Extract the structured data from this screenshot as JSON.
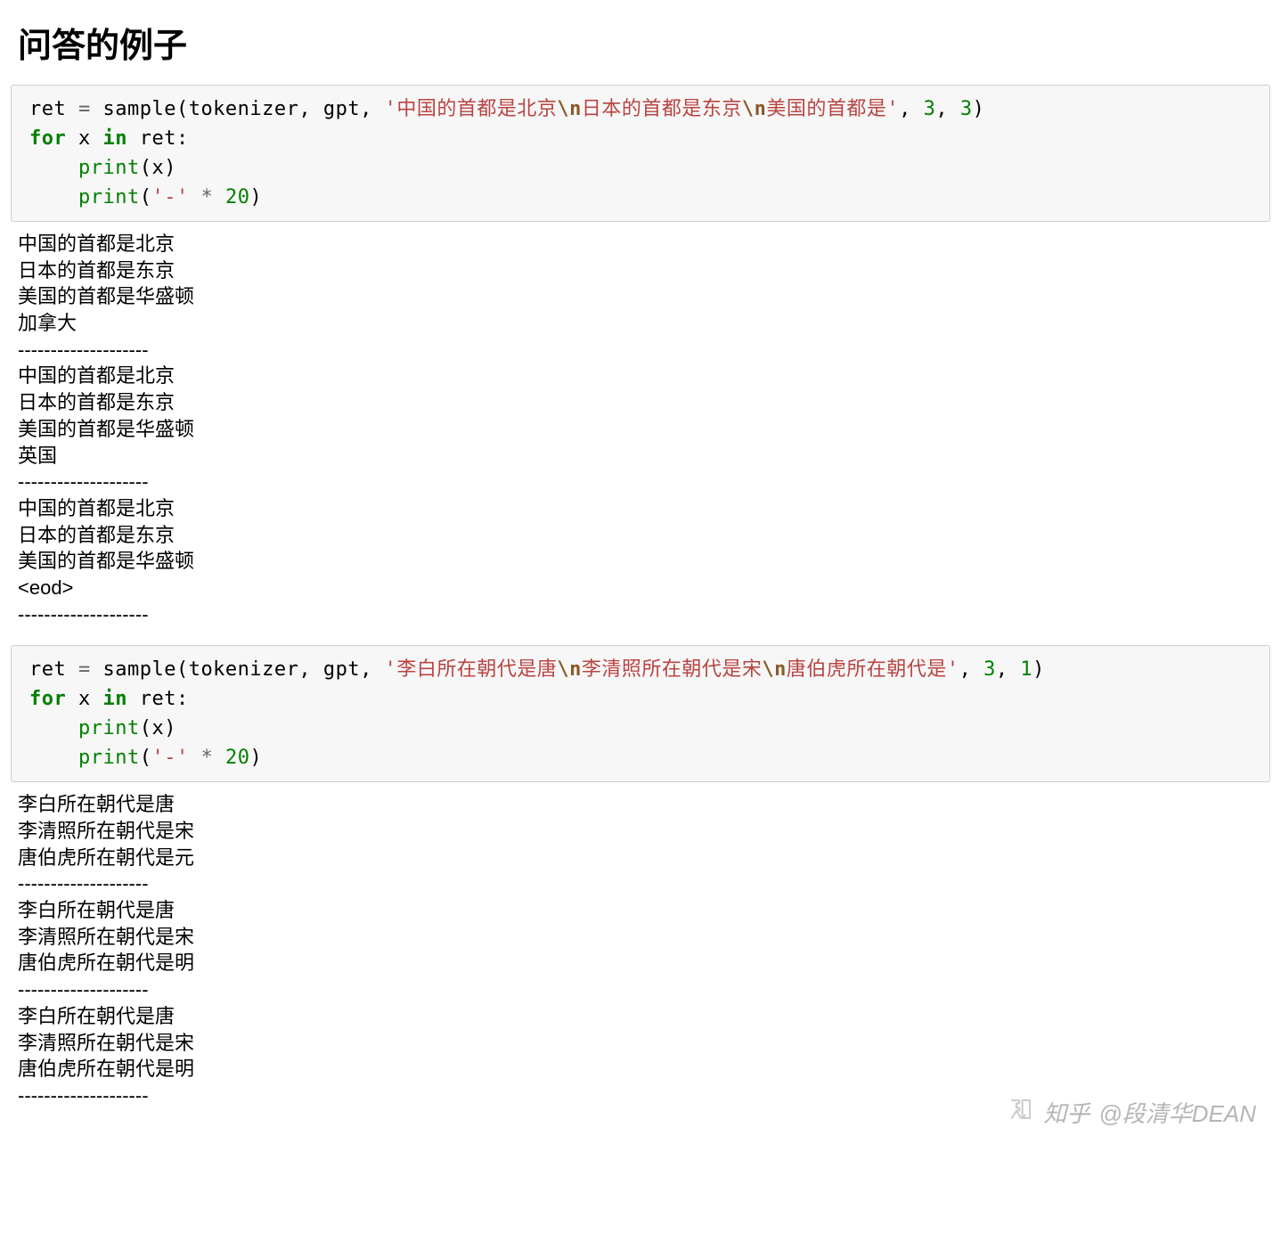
{
  "heading": "问答的例子",
  "cells": [
    {
      "code": {
        "line1_pre": "ret ",
        "line1_eq": "=",
        "line1_post": " sample(tokenizer, gpt, ",
        "str_open": "'",
        "str_p1": "中国的首都是北京",
        "str_e1": "\\n",
        "str_p2": "日本的首都是东京",
        "str_e2": "\\n",
        "str_p3": "美国的首都是",
        "str_close": "'",
        "line1_tail": ", ",
        "arg_a": "3",
        "comma": ", ",
        "arg_b": "3",
        "line1_end": ")",
        "line2_for": "for",
        "line2_mid": " x ",
        "line2_in": "in",
        "line2_rest": " ret:",
        "line3_indent": "    ",
        "line3_print": "print",
        "line3_rest": "(x)",
        "line4_indent": "    ",
        "line4_print": "print",
        "line4_open": "(",
        "line4_str": "'-'",
        "line4_mid": " ",
        "line4_op": "*",
        "line4_sp": " ",
        "line4_num": "20",
        "line4_end": ")"
      },
      "output": "中国的首都是北京\n日本的首都是东京\n美国的首都是华盛顿\n加拿大\n--------------------\n中国的首都是北京\n日本的首都是东京\n美国的首都是华盛顿\n英国\n--------------------\n中国的首都是北京\n日本的首都是东京\n美国的首都是华盛顿\n<eod>\n--------------------"
    },
    {
      "code": {
        "line1_pre": "ret ",
        "line1_eq": "=",
        "line1_post": " sample(tokenizer, gpt, ",
        "str_open": "'",
        "str_p1": "李白所在朝代是唐",
        "str_e1": "\\n",
        "str_p2": "李清照所在朝代是宋",
        "str_e2": "\\n",
        "str_p3": "唐伯虎所在朝代是",
        "str_close": "'",
        "line1_tail": ", ",
        "arg_a": "3",
        "comma": ", ",
        "arg_b": "1",
        "line1_end": ")",
        "line2_for": "for",
        "line2_mid": " x ",
        "line2_in": "in",
        "line2_rest": " ret:",
        "line3_indent": "    ",
        "line3_print": "print",
        "line3_rest": "(x)",
        "line4_indent": "    ",
        "line4_print": "print",
        "line4_open": "(",
        "line4_str": "'-'",
        "line4_mid": " ",
        "line4_op": "*",
        "line4_sp": " ",
        "line4_num": "20",
        "line4_end": ")"
      },
      "output": "李白所在朝代是唐\n李清照所在朝代是宋\n唐伯虎所在朝代是元\n--------------------\n李白所在朝代是唐\n李清照所在朝代是宋\n唐伯虎所在朝代是明\n--------------------\n李白所在朝代是唐\n李清照所在朝代是宋\n唐伯虎所在朝代是明\n--------------------"
    }
  ],
  "watermark": {
    "site": "知乎",
    "handle": "@段清华DEAN"
  }
}
